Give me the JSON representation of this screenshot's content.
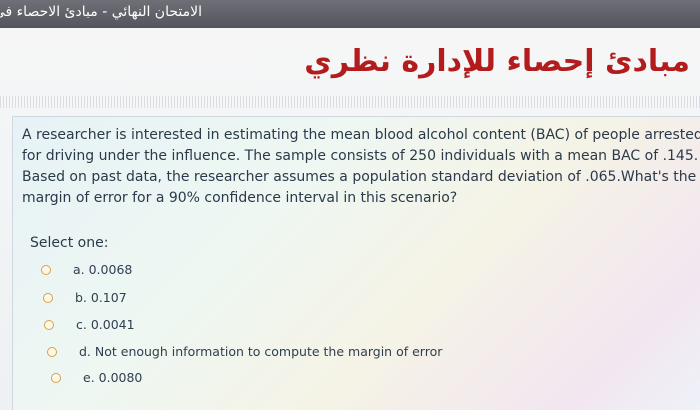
{
  "header": {
    "breadcrumb": "الامتحان النهائي - مبادئ الاحصاء في ا"
  },
  "course": {
    "title": "مبادئ إحصاء للإدارة نظري"
  },
  "question": {
    "lines": [
      "A researcher is interested in estimating the mean blood alcohol content (BAC) of people arrested",
      "for driving under the influence. The sample consists of 250 individuals with a mean BAC of .145.",
      "Based on past data, the researcher assumes a population standard deviation of .065.What's the",
      "margin of error for a 90% confidence interval in this scenario?"
    ],
    "select_label": "Select one:",
    "options": [
      "a. 0.0068",
      "b. 0.107",
      "c. 0.0041",
      "d. Not enough information to compute the margin of error",
      "e. 0.0080"
    ]
  },
  "colors": {
    "topbar": "#5b5b66",
    "course_title": "#b31c1c",
    "radio_border": "#d7a24a"
  }
}
